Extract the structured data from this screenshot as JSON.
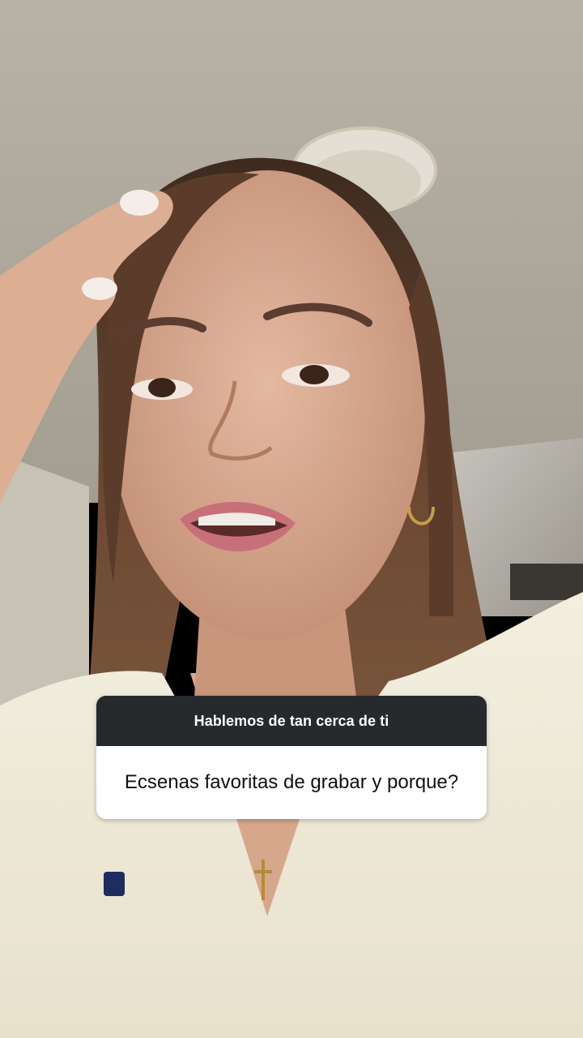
{
  "question_sticker": {
    "header": "Hablemos de tan cerca de ti",
    "question": "Ecsenas favoritas de grabar y porque?"
  },
  "colors": {
    "sticker_header_bg": "#262a2d",
    "sticker_body_bg": "#ffffff"
  }
}
